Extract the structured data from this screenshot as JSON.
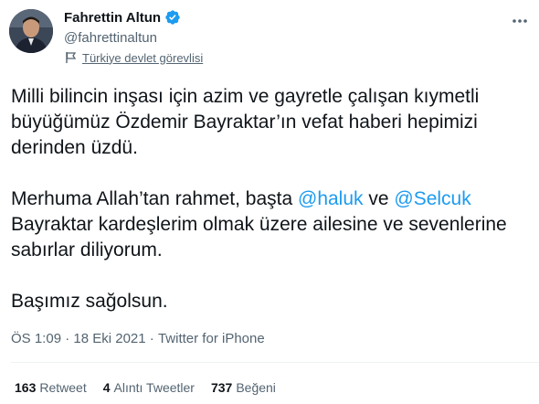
{
  "author": {
    "display_name": "Fahrettin Altun",
    "handle": "@fahrettinaltun",
    "label": "Türkiye devlet görevlisi",
    "verified_icon": "verified-badge-icon",
    "label_icon": "flag-icon"
  },
  "tweet": {
    "paragraph1": "Milli bilincin inşası için azim ve gayretle çalışan kıymetli büyüğümüz Özdemir Bayraktar’ın vefat haberi hepimizi derinden üzdü.",
    "p2_part1": "Merhuma Allah’tan rahmet, başta ",
    "mention1": "@haluk",
    "p2_part2": " ve ",
    "mention2": "@Selcuk",
    "p2_part3": " Bayraktar kardeşlerim olmak üzere ailesine ve sevenlerine sabırlar diliyorum.",
    "paragraph3": "Başımız sağolsun."
  },
  "meta": {
    "time": "ÖS 1:09",
    "separator": " · ",
    "date": "18 Eki 2021",
    "source": "Twitter for iPhone"
  },
  "stats": {
    "retweets_count": "163",
    "retweets_label": "Retweet",
    "quotes_count": "4",
    "quotes_label": "Alıntı Tweetler",
    "likes_count": "737",
    "likes_label": "Beğeni"
  },
  "colors": {
    "accent": "#1d9bf0",
    "text": "#0f1419",
    "secondary": "#536471"
  }
}
